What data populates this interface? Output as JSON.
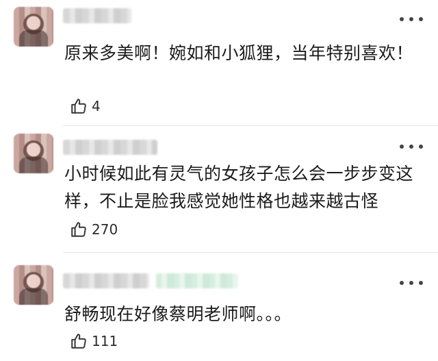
{
  "comments": [
    {
      "text": "原来多美啊！婉如和小狐狸，当年特别喜欢！",
      "likes": "4"
    },
    {
      "text": "小时候如此有灵气的女孩子怎么会一步步变这样，不止是脸我感觉她性格也越来越古怪",
      "likes": "270"
    },
    {
      "text": "舒畅现在好像蔡明老师啊。。。",
      "likes": "111"
    }
  ],
  "icons": {
    "like": "thumbs-up-icon",
    "more": "more-options-icon"
  },
  "colors": {
    "text": "#1b1b1b",
    "divider": "#e6e6e6"
  }
}
